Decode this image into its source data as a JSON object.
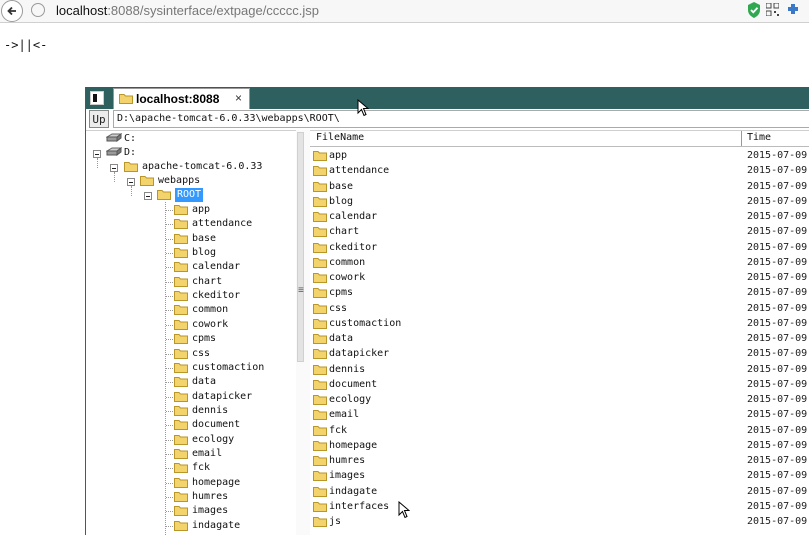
{
  "browser": {
    "url_host": "localhost",
    "url_rest": ":8088/sysinterface/extpage/ccccc.jsp"
  },
  "page_text": "->||<-",
  "app": {
    "tab_title": "localhost:8088",
    "tab_close": "×",
    "up_label": "Up",
    "path": "D:\\apache-tomcat-6.0.33\\webapps\\ROOT\\"
  },
  "tree": {
    "drives": [
      "C:",
      "D:"
    ],
    "nodes": [
      "apache-tomcat-6.0.33",
      "webapps",
      "ROOT"
    ],
    "children": [
      "app",
      "attendance",
      "base",
      "blog",
      "calendar",
      "chart",
      "ckeditor",
      "common",
      "cowork",
      "cpms",
      "css",
      "customaction",
      "data",
      "datapicker",
      "dennis",
      "document",
      "ecology",
      "email",
      "fck",
      "homepage",
      "humres",
      "images",
      "indagate"
    ]
  },
  "filelist": {
    "col_name": "FileName",
    "col_time": "Time",
    "rows": [
      {
        "name": "app",
        "time": "2015-07-09"
      },
      {
        "name": "attendance",
        "time": "2015-07-09"
      },
      {
        "name": "base",
        "time": "2015-07-09"
      },
      {
        "name": "blog",
        "time": "2015-07-09"
      },
      {
        "name": "calendar",
        "time": "2015-07-09"
      },
      {
        "name": "chart",
        "time": "2015-07-09"
      },
      {
        "name": "ckeditor",
        "time": "2015-07-09"
      },
      {
        "name": "common",
        "time": "2015-07-09"
      },
      {
        "name": "cowork",
        "time": "2015-07-09"
      },
      {
        "name": "cpms",
        "time": "2015-07-09"
      },
      {
        "name": "css",
        "time": "2015-07-09"
      },
      {
        "name": "customaction",
        "time": "2015-07-09"
      },
      {
        "name": "data",
        "time": "2015-07-09"
      },
      {
        "name": "datapicker",
        "time": "2015-07-09"
      },
      {
        "name": "dennis",
        "time": "2015-07-09"
      },
      {
        "name": "document",
        "time": "2015-07-09"
      },
      {
        "name": "ecology",
        "time": "2015-07-09"
      },
      {
        "name": "email",
        "time": "2015-07-09"
      },
      {
        "name": "fck",
        "time": "2015-07-09"
      },
      {
        "name": "homepage",
        "time": "2015-07-09"
      },
      {
        "name": "humres",
        "time": "2015-07-09"
      },
      {
        "name": "images",
        "time": "2015-07-09"
      },
      {
        "name": "indagate",
        "time": "2015-07-09"
      },
      {
        "name": "interfaces",
        "time": "2015-07-09"
      },
      {
        "name": "js",
        "time": "2015-07-09"
      }
    ]
  }
}
